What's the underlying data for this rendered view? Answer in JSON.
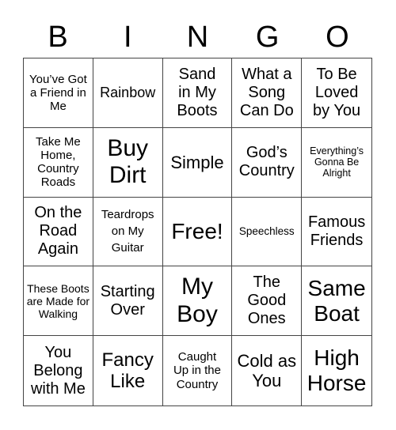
{
  "header": {
    "letters": [
      "B",
      "I",
      "N",
      "G",
      "O"
    ]
  },
  "card": {
    "cells": [
      "You’ve Got a Friend in Me",
      "Rainbow",
      "Sand in My Boots",
      "What a Song Can Do",
      "To Be Loved by You",
      "Take Me Home, Country Roads",
      "Buy Dirt",
      "Simple",
      "God’s Country",
      "Everything’s Gonna Be Alright",
      "On the Road Again",
      "Teardrops on My Guitar",
      "Free!",
      "Speechless",
      "Famous Friends",
      "These Boots are Made for Walking",
      "Starting Over",
      "My Boy",
      "The Good Ones",
      "Same Boat",
      "You Belong with Me",
      "Fancy Like",
      "Caught Up in the Country",
      "Cold as You",
      "High Horse"
    ],
    "free_space": "Free!"
  }
}
